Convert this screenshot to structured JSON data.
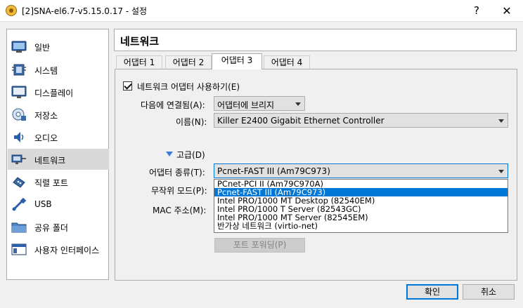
{
  "window": {
    "title": "[2]SNA-el6.7-v5.15.0.17 - 설정",
    "help_glyph": "?",
    "close_glyph": "✕"
  },
  "sidebar": {
    "items": [
      {
        "label": "일반",
        "icon": "general-icon",
        "selected": false
      },
      {
        "label": "시스템",
        "icon": "system-icon",
        "selected": false
      },
      {
        "label": "디스플레이",
        "icon": "display-icon",
        "selected": false
      },
      {
        "label": "저장소",
        "icon": "storage-icon",
        "selected": false
      },
      {
        "label": "오디오",
        "icon": "audio-icon",
        "selected": false
      },
      {
        "label": "네트워크",
        "icon": "network-icon",
        "selected": true
      },
      {
        "label": "직렬 포트",
        "icon": "serial-port-icon",
        "selected": false
      },
      {
        "label": "USB",
        "icon": "usb-icon",
        "selected": false
      },
      {
        "label": "공유 폴더",
        "icon": "shared-folder-icon",
        "selected": false
      },
      {
        "label": "사용자 인터페이스",
        "icon": "user-interface-icon",
        "selected": false
      }
    ]
  },
  "page": {
    "title": "네트워크"
  },
  "tabs": [
    {
      "label": "어댑터 1",
      "active": false
    },
    {
      "label": "어댑터 2",
      "active": false
    },
    {
      "label": "어댑터 3",
      "active": true
    },
    {
      "label": "어댑터 4",
      "active": false
    }
  ],
  "form": {
    "enable_label": "네트워크 어댑터 사용하기(E)",
    "enable_checked": true,
    "attached_label": "다음에 연결됨(A):",
    "attached_value": "어댑터에 브리지",
    "name_label": "이름(N):",
    "name_value": "Killer E2400 Gigabit Ethernet Controller",
    "advanced_label": "고급(D)",
    "adapter_type_label": "어댑터 종류(T):",
    "adapter_type_value": "Pcnet-FAST III (Am79C973)",
    "promisc_label": "무작위 모드(P):",
    "mac_label": "MAC 주소(M):",
    "port_forward_label": "포트 포워딩(P)"
  },
  "adapter_type_options": [
    "PCnet-PCI II (Am79C970A)",
    "Pcnet-FAST III (Am79C973)",
    "Intel PRO/1000 MT Desktop (82540EM)",
    "Intel PRO/1000 T Server (82543GC)",
    "Intel PRO/1000 MT Server (82545EM)",
    "반가상 네트워크 (virtio-net)"
  ],
  "adapter_type_selected_index": 1,
  "buttons": {
    "ok": "확인",
    "cancel": "취소"
  },
  "colors": {
    "accent": "#0078d7",
    "selection": "#d9d9d9",
    "disabled": "#cccccc"
  }
}
